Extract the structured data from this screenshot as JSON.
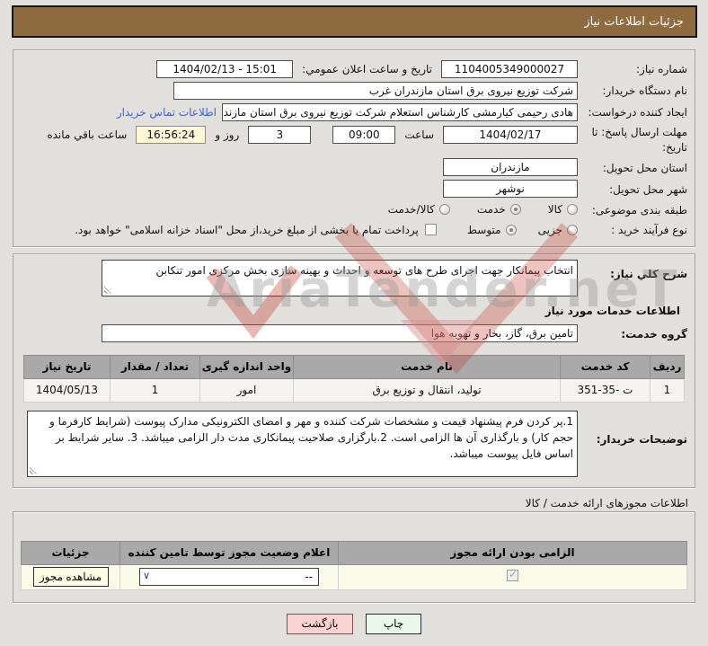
{
  "title_bar": {
    "title": "جزئیات اطلاعات نیاز"
  },
  "info": {
    "need_number_label": "شماره نیاز:",
    "need_number_value": "1104005349000027",
    "announce_datetime_label": "تاریخ و ساعت اعلان عمومي:",
    "announce_datetime_value": "1404/02/13 - 15:01",
    "buyer_org_label": "نام دستگاه خریدار:",
    "buyer_org_value": "شرکت توزیع نیروی برق استان مازندران غرب",
    "creator_label": "ایجاد کننده درخواست:",
    "creator_value": "هادی رحیمی کیارمشی کارشناس استعلام شرکت توزیع نیروی برق استان مازند",
    "contact_link_label": "اطلاعات تماس خریدار",
    "deadline_label": "مهلت ارسال پاسخ: تا تاریخ:",
    "deadline_date": "1404/02/17",
    "hour_label": "ساعت",
    "deadline_time": "09:00",
    "days_value": "3",
    "days_and_label": "روز و",
    "remaining_time": "16:56:24",
    "remaining_label": "ساعت باقي مانده",
    "province_label": "استان محل تحویل:",
    "province_value": "مازندران",
    "city_label": "شهر محل تحویل:",
    "city_value": "نوشهر",
    "classification_label": "طبقه بندی موضوعی:",
    "classification_options": [
      "کالا",
      "خدمت",
      "کالا/خدمت"
    ],
    "classification_selected": "خدمت",
    "process_label": "نوع فرآیند خرید :",
    "process_options": [
      "جزیی",
      "متوسط"
    ],
    "process_selected": "متوسط",
    "treasury_note": "پرداخت تمام یا بخشی از مبلغ خرید،از محل \"اسناد خزانه اسلامی\" خواهد بود."
  },
  "need_summary": {
    "label": "شرح کلي نیاز:",
    "value": "انتخاب پیمانکار جهت اجرای طرح های توسعه و احداث و بهینه سازی بخش مرکزی امور تنکابن"
  },
  "services": {
    "section_title": "اطلاعات خدمات مورد نیاز",
    "group_label": "گروه خدمت:",
    "group_value": "تامین برق، گاز، بخار و تهویه هوا",
    "table": {
      "headers": [
        "ردیف",
        "کد خدمت",
        "نام خدمت",
        "واحد اندازه گیری",
        "تعداد / مقدار",
        "تاریخ نیاز"
      ],
      "row": {
        "index": "1",
        "code": "351-35- ت",
        "name": "تولید، انتقال و توزیع برق",
        "unit": "امور",
        "quantity": "1",
        "date": "1404/05/13"
      }
    }
  },
  "buyer_notes": {
    "label": "توضیحات خریدار:",
    "value": "1.پر کردن فرم پیشنهاد قیمت و مشخصات شرکت کننده و مهر و امضای الکترونیکی مدارک پیوست (شرایط کارفرما و حجم کار) و بارگذاری آن ها الزامی است. 2.بارگزاری صلاحیت پیمانکاری مدت دار الزامی میباشد. 3. سایر شرایط بر اساس فایل پیوست میباشد."
  },
  "permits": {
    "section_title": "اطلاعات مجوزهای ارائه خدمت / کالا",
    "table": {
      "headers": [
        "الزامی بودن ارائه مجوز",
        "اعلام وضعیت مجوز توسط تامین کننده",
        "جزئیات"
      ],
      "required_checked": "true",
      "status_select_value": "--",
      "details_button_label": "مشاهده مجوز"
    }
  },
  "footer": {
    "print_label": "چاپ",
    "back_label": "بازگشت"
  },
  "watermark": {
    "text": "AriaTender.neT"
  },
  "colors": {
    "titlebar": "#8e6c40",
    "link": "#3d63cc",
    "highlight_field": "#fdf6d8",
    "table_header": "#a9a9a9",
    "watermark_red": "#c0392b"
  }
}
